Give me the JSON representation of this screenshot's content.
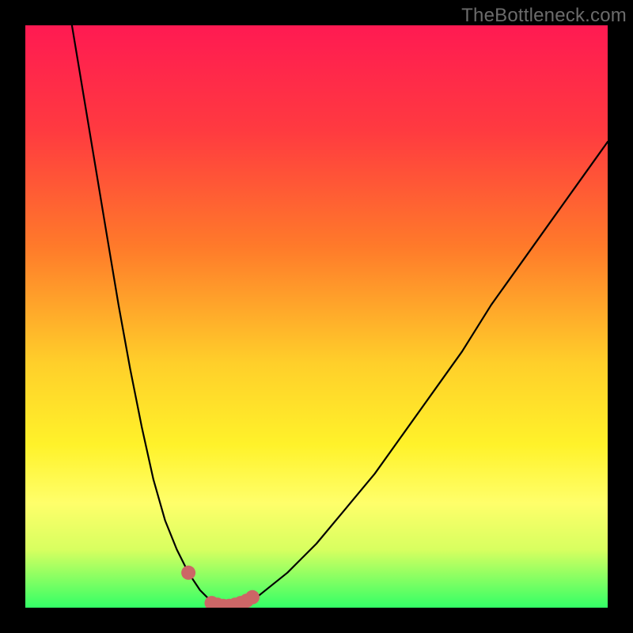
{
  "watermark": {
    "text": "TheBottleneck.com"
  },
  "chart_data": {
    "type": "line",
    "title": "",
    "xlabel": "",
    "ylabel": "",
    "xlim": [
      0,
      100
    ],
    "ylim": [
      0,
      100
    ],
    "series": [
      {
        "name": "bottleneck-curve",
        "x": [
          8,
          10,
          12,
          14,
          16,
          18,
          20,
          22,
          24,
          26,
          28,
          30,
          32,
          34,
          36,
          38,
          40,
          45,
          50,
          55,
          60,
          65,
          70,
          75,
          80,
          85,
          90,
          95,
          100
        ],
        "values": [
          100,
          88,
          76,
          64,
          52,
          41,
          31,
          22,
          15,
          10,
          6,
          3,
          1,
          0,
          0,
          1,
          2,
          6,
          11,
          17,
          23,
          30,
          37,
          44,
          52,
          59,
          66,
          73,
          80
        ]
      }
    ],
    "markers": {
      "name": "highlighted-points",
      "x": [
        28,
        32,
        33,
        34,
        35,
        36,
        37,
        38,
        39
      ],
      "values": [
        6,
        0.8,
        0.5,
        0.3,
        0.3,
        0.5,
        0.8,
        1.2,
        1.8
      ]
    },
    "background_gradient": {
      "orientation": "vertical",
      "stops": [
        {
          "pos": 0.0,
          "color": "#ff1a52"
        },
        {
          "pos": 0.18,
          "color": "#ff3a40"
        },
        {
          "pos": 0.38,
          "color": "#ff7a2a"
        },
        {
          "pos": 0.58,
          "color": "#ffcf2a"
        },
        {
          "pos": 0.72,
          "color": "#fff22a"
        },
        {
          "pos": 0.82,
          "color": "#ffff6a"
        },
        {
          "pos": 0.9,
          "color": "#d8ff60"
        },
        {
          "pos": 1.0,
          "color": "#33ff66"
        }
      ]
    }
  }
}
